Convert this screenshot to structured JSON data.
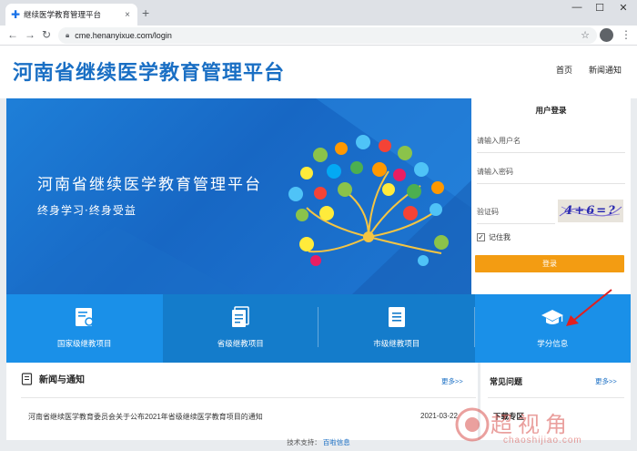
{
  "browser": {
    "tab_title": "继续医学教育管理平台",
    "tab_close": "×",
    "new_tab": "+",
    "url": "cme.henanyixue.com/login"
  },
  "header": {
    "site_title": "河南省继续医学教育管理平台",
    "nav": [
      "首页",
      "新闻通知"
    ]
  },
  "banner": {
    "title": "河南省继续医学教育管理平台",
    "subtitle": "终身学习·终身受益"
  },
  "login": {
    "title": "用户登录",
    "username_placeholder": "请输入用户名",
    "password_placeholder": "请输入密码",
    "captcha_label": "验证码",
    "captcha_text": "4+6=?",
    "remember_label": "记住我",
    "submit_label": "登录"
  },
  "categories": [
    {
      "label": "国家级继教项目",
      "icon": "certificate-icon"
    },
    {
      "label": "省级继教项目",
      "icon": "documents-icon"
    },
    {
      "label": "市级继教项目",
      "icon": "document-icon"
    },
    {
      "label": "学分信息",
      "icon": "graduation-cap-icon"
    }
  ],
  "news": {
    "heading": "新闻与通知",
    "more": "更多>>",
    "items": [
      {
        "title": "河南省继续医学教育委员会关于公布2021年省级继续医学教育项目的通知",
        "date": "2021-03-22"
      }
    ]
  },
  "faq": {
    "heading": "常见问题",
    "more": "更多>>",
    "download_heading": "下载专区"
  },
  "footer": {
    "label": "技术支持：",
    "link": "百啦信息"
  },
  "watermark": {
    "text": "超视角",
    "sub": "chaoshijiao.com"
  },
  "colors": {
    "brand": "#1a6fc4",
    "banner": "#1e7fd8",
    "strip": "#1b88dc",
    "login_button": "#f39c12",
    "annotation_arrow": "#e02020"
  }
}
